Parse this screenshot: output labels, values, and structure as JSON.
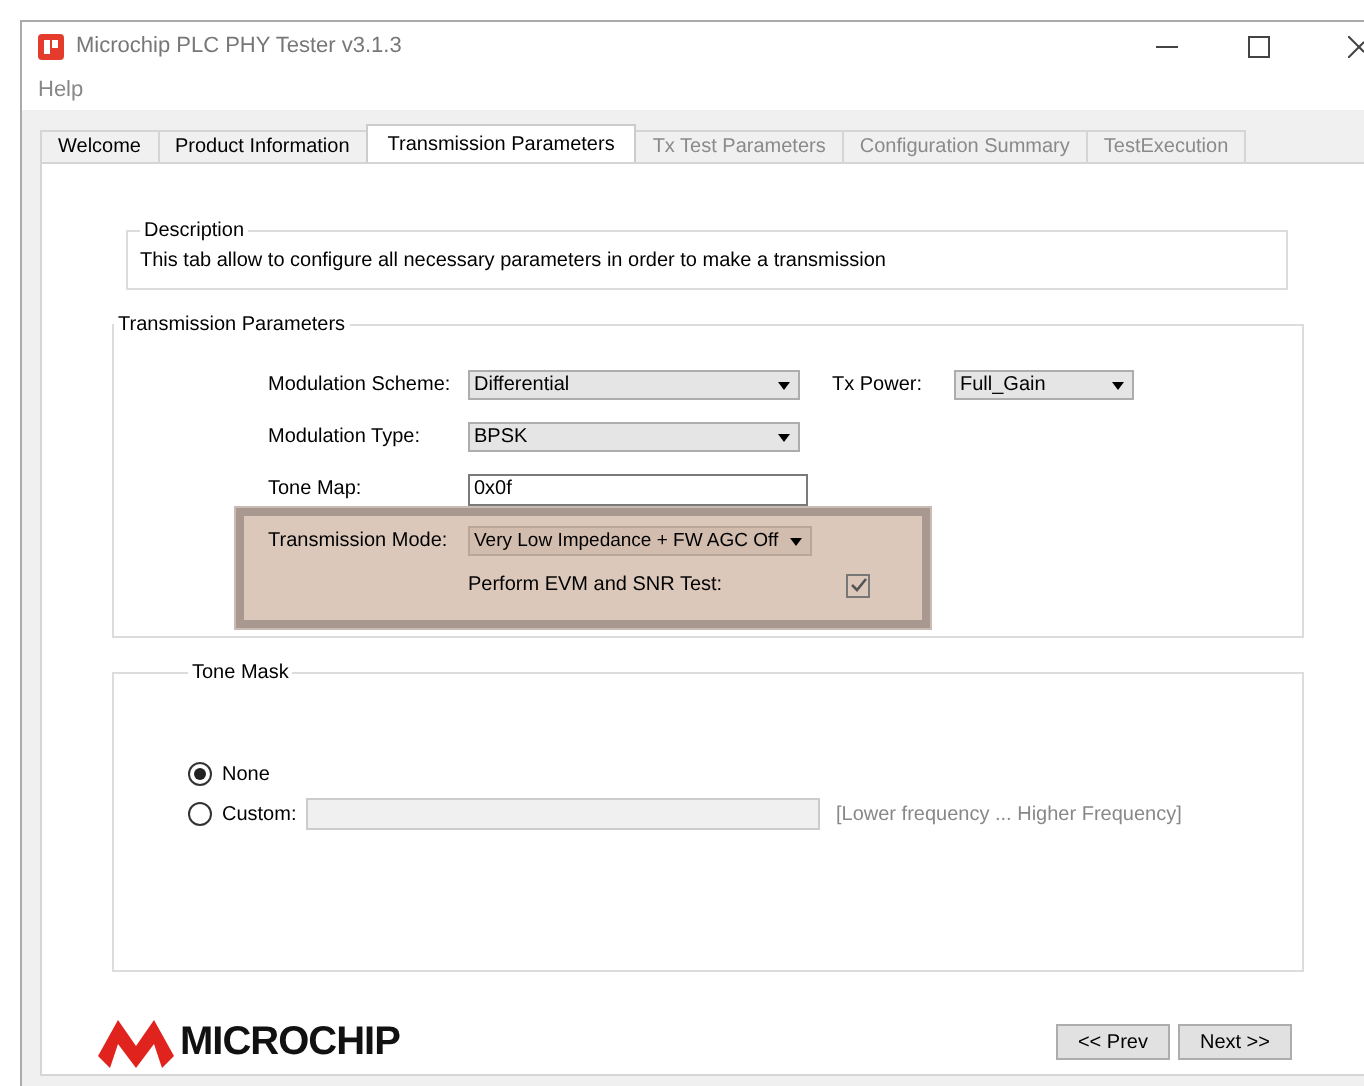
{
  "window": {
    "title": "Microchip PLC PHY Tester v3.1.3"
  },
  "menu": [
    "Help"
  ],
  "tabs": [
    {
      "label": "Welcome",
      "selected": false,
      "disabled": false
    },
    {
      "label": "Product Information",
      "selected": false,
      "disabled": false
    },
    {
      "label": "Transmission Parameters",
      "selected": true,
      "disabled": false
    },
    {
      "label": "Tx Test Parameters",
      "selected": false,
      "disabled": true
    },
    {
      "label": "Configuration Summary",
      "selected": false,
      "disabled": true
    },
    {
      "label": "TestExecution",
      "selected": false,
      "disabled": true
    }
  ],
  "description": {
    "title": "Description",
    "text": "This tab allow to configure all necessary  parameters in order to make a transmission"
  },
  "transmission_parameters": {
    "title": "Transmission Parameters",
    "modulation_scheme": {
      "label": "Modulation Scheme:",
      "value": "Differential"
    },
    "tx_power": {
      "label": "Tx Power:",
      "value": "Full_Gain"
    },
    "modulation_type": {
      "label": "Modulation Type:",
      "value": "BPSK"
    },
    "tone_map": {
      "label": "Tone Map:",
      "value": "0x0f"
    },
    "transmission_mode": {
      "label": "Transmission Mode:",
      "value": "Very Low Impedance + FW AGC Off"
    },
    "evm_snr_test": {
      "label": "Perform EVM and SNR Test:",
      "checked": true
    }
  },
  "tone_mask": {
    "title": "Tone Mask",
    "options": [
      {
        "label": "None",
        "selected": true
      },
      {
        "label": "Custom:",
        "selected": false
      }
    ],
    "custom_field": {
      "disabled": true
    },
    "hint": "[Lower frequency ... Higher Frequency]"
  },
  "logo": {
    "text": "MICROCHIP"
  },
  "buttons": [
    "<< Prev",
    "Next >>"
  ]
}
